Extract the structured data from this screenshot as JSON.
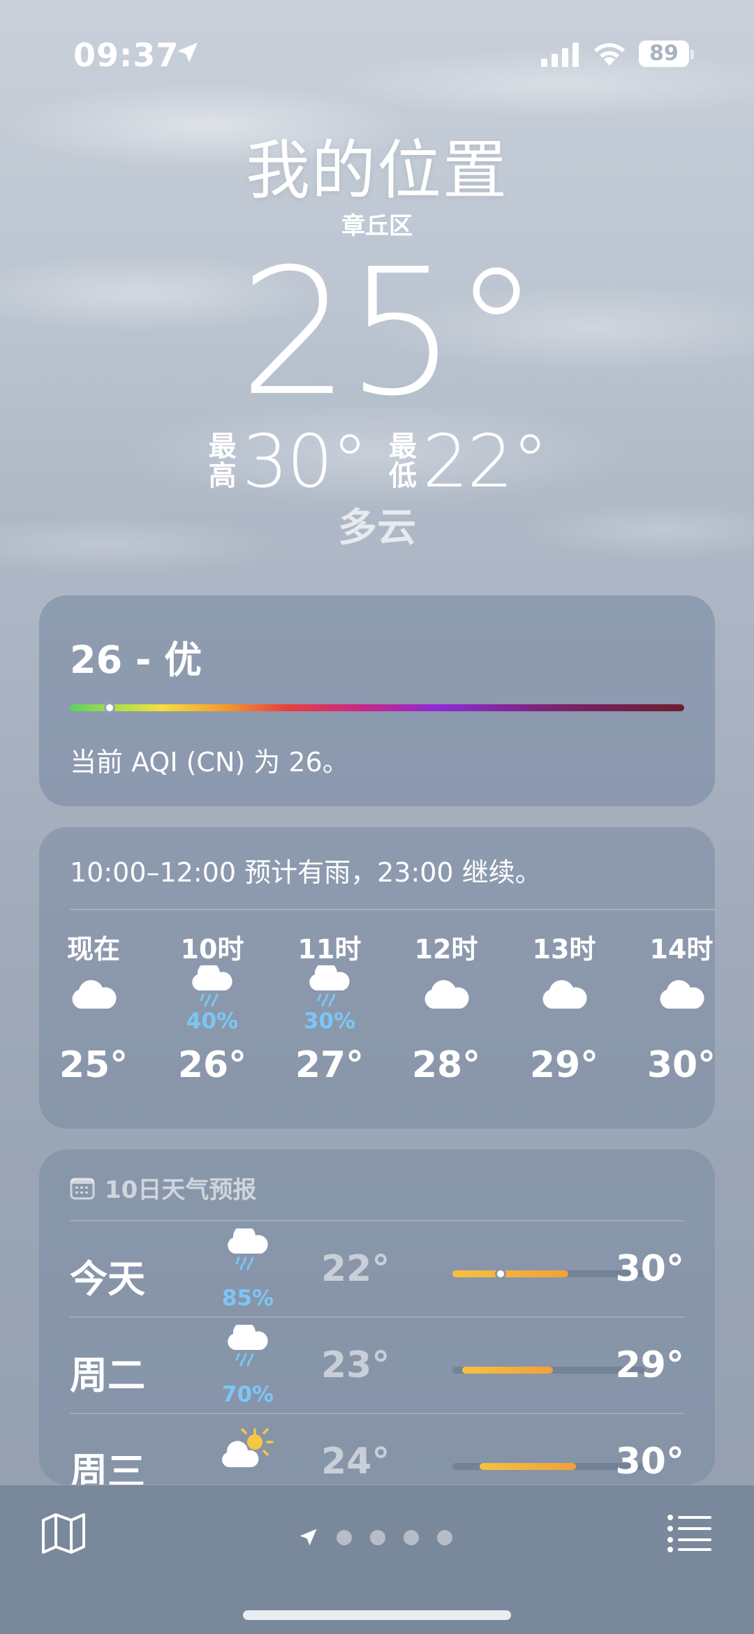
{
  "status_bar": {
    "time": "09:37",
    "battery": "89",
    "icons": [
      "location-arrow-icon",
      "cellular-signal-icon",
      "wifi-icon",
      "battery-icon"
    ]
  },
  "header": {
    "title": "我的位置",
    "district": "章丘区",
    "current_temp": "25°",
    "high_label": "最高",
    "high_value": "30°",
    "low_label": "最低",
    "low_value": "22°",
    "condition": "多云"
  },
  "aqi": {
    "value": "26 - 优",
    "description": "当前 AQI (CN) 为 26。",
    "level": 26
  },
  "hourly": {
    "summary": "10:00–12:00 预计有雨，23:00 继续。",
    "items": [
      {
        "hour": "现在",
        "icon": "cloud-icon",
        "pct": "",
        "temp": "25°"
      },
      {
        "hour": "10时",
        "icon": "cloud-rain-icon",
        "pct": "40%",
        "temp": "26°"
      },
      {
        "hour": "11时",
        "icon": "cloud-rain-icon",
        "pct": "30%",
        "temp": "27°"
      },
      {
        "hour": "12时",
        "icon": "cloud-icon",
        "pct": "",
        "temp": "28°"
      },
      {
        "hour": "13时",
        "icon": "cloud-icon",
        "pct": "",
        "temp": "29°"
      },
      {
        "hour": "14时",
        "icon": "cloud-icon",
        "pct": "",
        "temp": "30°"
      }
    ]
  },
  "daily": {
    "heading": "10日天气预报",
    "days": [
      {
        "day": "今天",
        "icon": "cloud-rain-icon",
        "pct": "85%",
        "low": "22°",
        "high": "30°",
        "bar_start": 0.0,
        "bar_end": 0.6,
        "now": 0.25
      },
      {
        "day": "周二",
        "icon": "cloud-rain-icon",
        "pct": "70%",
        "low": "23°",
        "high": "29°",
        "bar_start": 0.05,
        "bar_end": 0.52
      },
      {
        "day": "周三",
        "icon": "partly-sunny-icon",
        "pct": "",
        "low": "24°",
        "high": "30°",
        "bar_start": 0.14,
        "bar_end": 0.64
      }
    ]
  },
  "bottom_bar": {
    "icons": [
      "map-icon",
      "location-arrow-icon",
      "list-icon"
    ],
    "page_dots": 4
  }
}
